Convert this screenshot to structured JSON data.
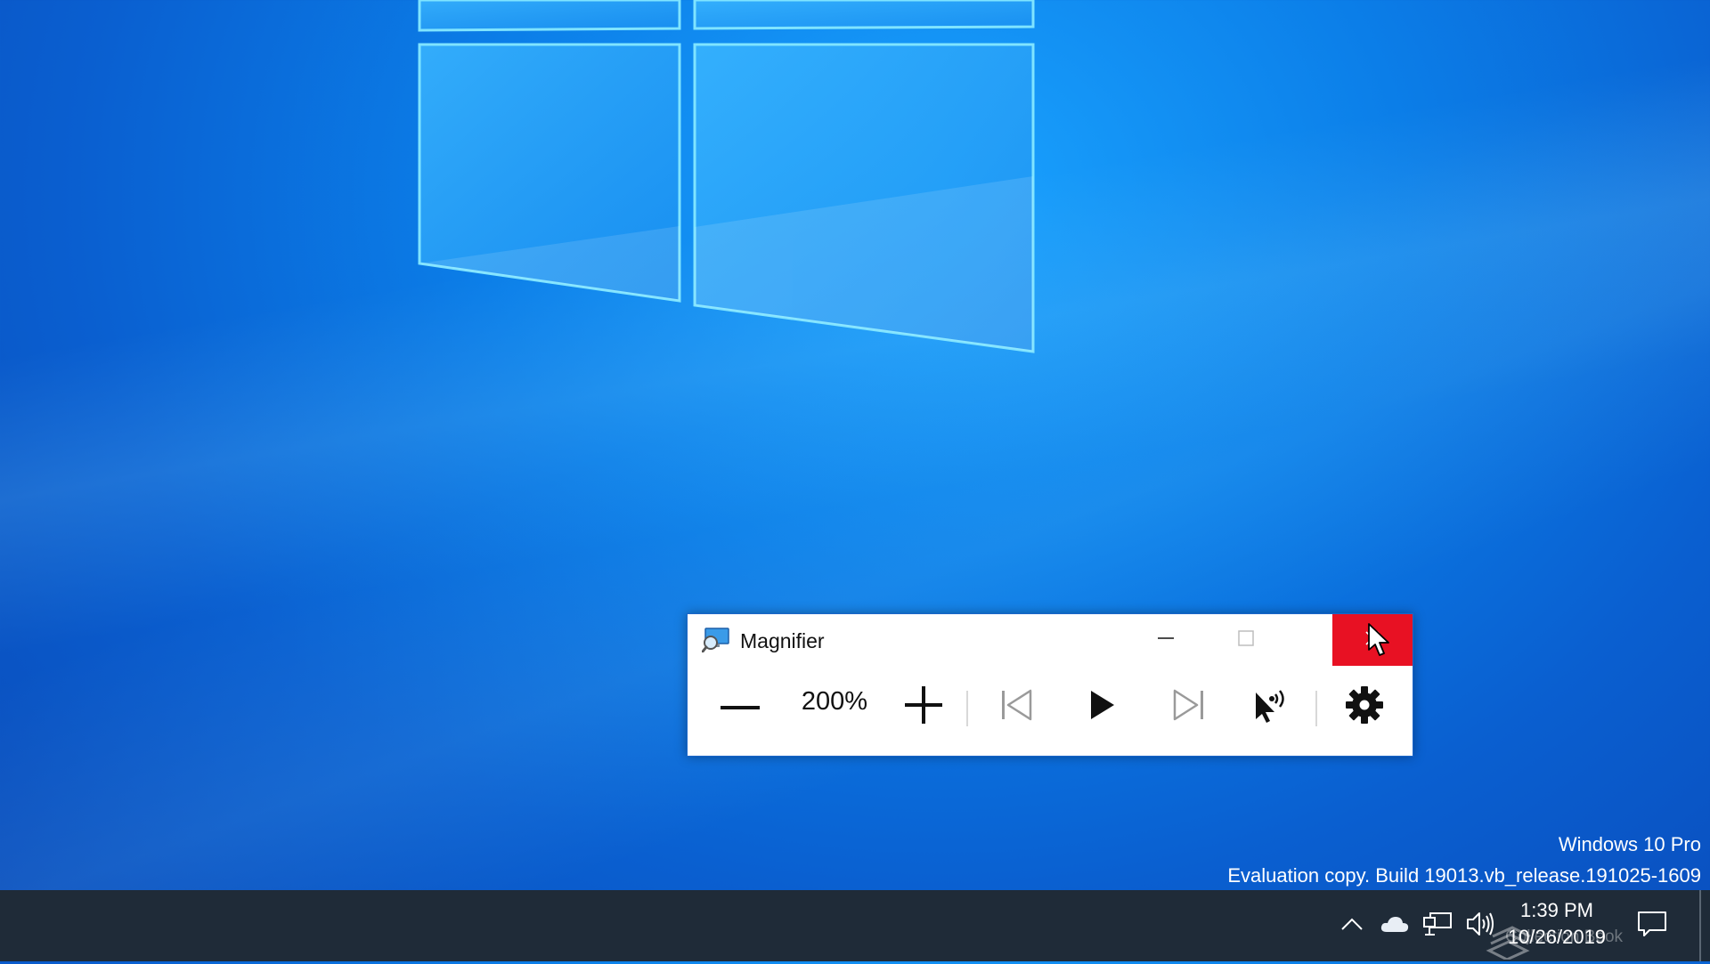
{
  "magnifier": {
    "title": "Magnifier",
    "zoom_level": "200%",
    "icons": {
      "app": "magnifier-app-icon",
      "minimize": "minimize-icon",
      "maximize": "maximize-icon",
      "close": "close-icon",
      "zoom_out": "minus-icon",
      "zoom_in": "plus-icon",
      "previous": "skip-previous-icon",
      "play": "play-icon",
      "next": "skip-next-icon",
      "read_from_pointer": "pointer-speak-icon",
      "settings": "gear-icon"
    },
    "colors": {
      "close_hover": "#e81123"
    }
  },
  "watermark": {
    "line1": "Windows 10 Pro",
    "line2": "Evaluation copy. Build 19013.vb_release.191025-1609"
  },
  "taskbar": {
    "clock_time": "1:39 PM",
    "clock_date": "10/26/2019",
    "overlay_text": "Collection Book",
    "tray_icons": [
      "chevron-up-icon",
      "onedrive-cloud-icon",
      "network-icon",
      "volume-icon",
      "action-center-icon"
    ]
  },
  "colors": {
    "taskbar": "#1f2b38",
    "desktop_accent": "#0b7ee8"
  }
}
